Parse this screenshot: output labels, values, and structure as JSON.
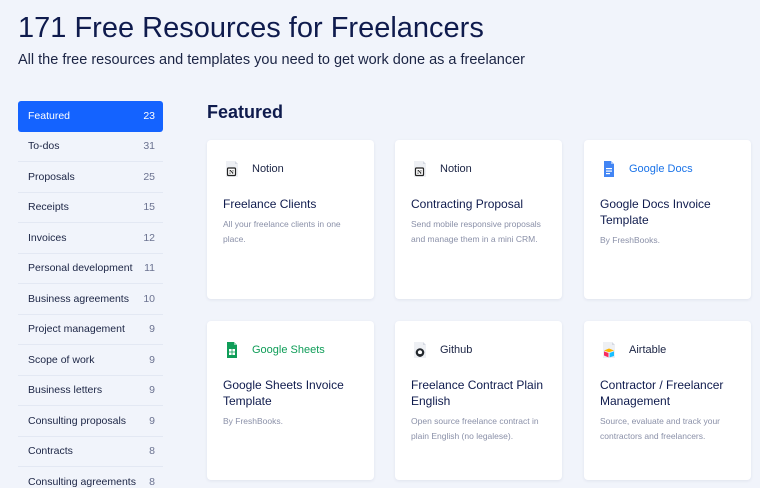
{
  "header": {
    "title": "171 Free Resources for Freelancers",
    "subtitle": "All the free resources and templates you need to get work done as a freelancer"
  },
  "sidebar": {
    "items": [
      {
        "label": "Featured",
        "count": "23",
        "active": true
      },
      {
        "label": "To-dos",
        "count": "31"
      },
      {
        "label": "Proposals",
        "count": "25"
      },
      {
        "label": "Receipts",
        "count": "15"
      },
      {
        "label": "Invoices",
        "count": "12"
      },
      {
        "label": "Personal development",
        "count": "11"
      },
      {
        "label": "Business agreements",
        "count": "10"
      },
      {
        "label": "Project management",
        "count": "9"
      },
      {
        "label": "Scope of work",
        "count": "9"
      },
      {
        "label": "Business letters",
        "count": "9"
      },
      {
        "label": "Consulting proposals",
        "count": "9"
      },
      {
        "label": "Contracts",
        "count": "8"
      },
      {
        "label": "Consulting agreements",
        "count": "8"
      }
    ]
  },
  "main": {
    "section_title": "Featured",
    "cards": [
      {
        "brand": "Notion",
        "icon": "notion-icon",
        "title": "Freelance Clients",
        "description": "All your freelance clients in one place."
      },
      {
        "brand": "Notion",
        "icon": "notion-icon",
        "title": "Contracting Proposal",
        "description": "Send mobile responsive proposals and manage them in a mini CRM."
      },
      {
        "brand": "Google Docs",
        "icon": "google-docs-icon",
        "title": "Google Docs Invoice Template",
        "description": "By FreshBooks."
      },
      {
        "brand": "Google Sheets",
        "icon": "google-sheets-icon",
        "title": "Google Sheets Invoice Template",
        "description": "By FreshBooks."
      },
      {
        "brand": "Github",
        "icon": "github-icon",
        "title": "Freelance Contract Plain English",
        "description": "Open source freelance contract in plain English (no legalese)."
      },
      {
        "brand": "Airtable",
        "icon": "airtable-icon",
        "title": "Contractor / Freelancer Management",
        "description": "Source, evaluate and track your contractors and freelancers."
      }
    ]
  },
  "colors": {
    "accent": "#1463ff",
    "background": "#f1f4fb",
    "heading": "#0f1b4d",
    "google_docs": "#1a73e8",
    "google_sheets": "#0f9d58"
  }
}
